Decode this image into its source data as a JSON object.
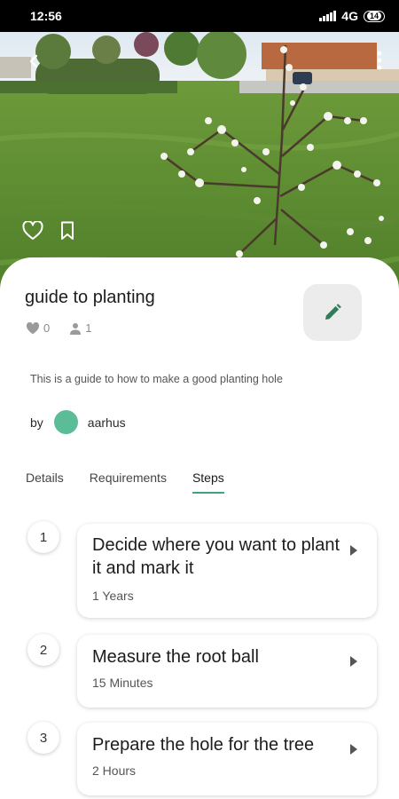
{
  "status_bar": {
    "time": "12:56",
    "network": "4G",
    "battery": "14"
  },
  "guide": {
    "title": "guide to planting",
    "likes": "0",
    "followers": "1",
    "description": "This is a guide to how to make a good planting hole",
    "author_prefix": "by",
    "author_name": "aarhus"
  },
  "tabs": [
    {
      "label": "Details",
      "active": false
    },
    {
      "label": "Requirements",
      "active": false
    },
    {
      "label": "Steps",
      "active": true
    }
  ],
  "steps": [
    {
      "number": "1",
      "title": "Decide where you want to plant it and mark it",
      "duration": "1 Years"
    },
    {
      "number": "2",
      "title": "Measure the root ball",
      "duration": "15 Minutes"
    },
    {
      "number": "3",
      "title": "Prepare the hole for the tree",
      "duration": "2 Hours"
    }
  ],
  "colors": {
    "accent": "#3aa580",
    "avatar": "#5bbd98",
    "edit_icon": "#2e7d5b"
  },
  "icons": {
    "back": "arrow-left-icon",
    "more": "more-vert-icon",
    "like": "heart-outline-icon",
    "save": "bookmark-outline-icon",
    "edit": "pencil-icon",
    "likes": "heart-icon",
    "followers": "person-icon",
    "step_open": "chevron-right-icon"
  }
}
